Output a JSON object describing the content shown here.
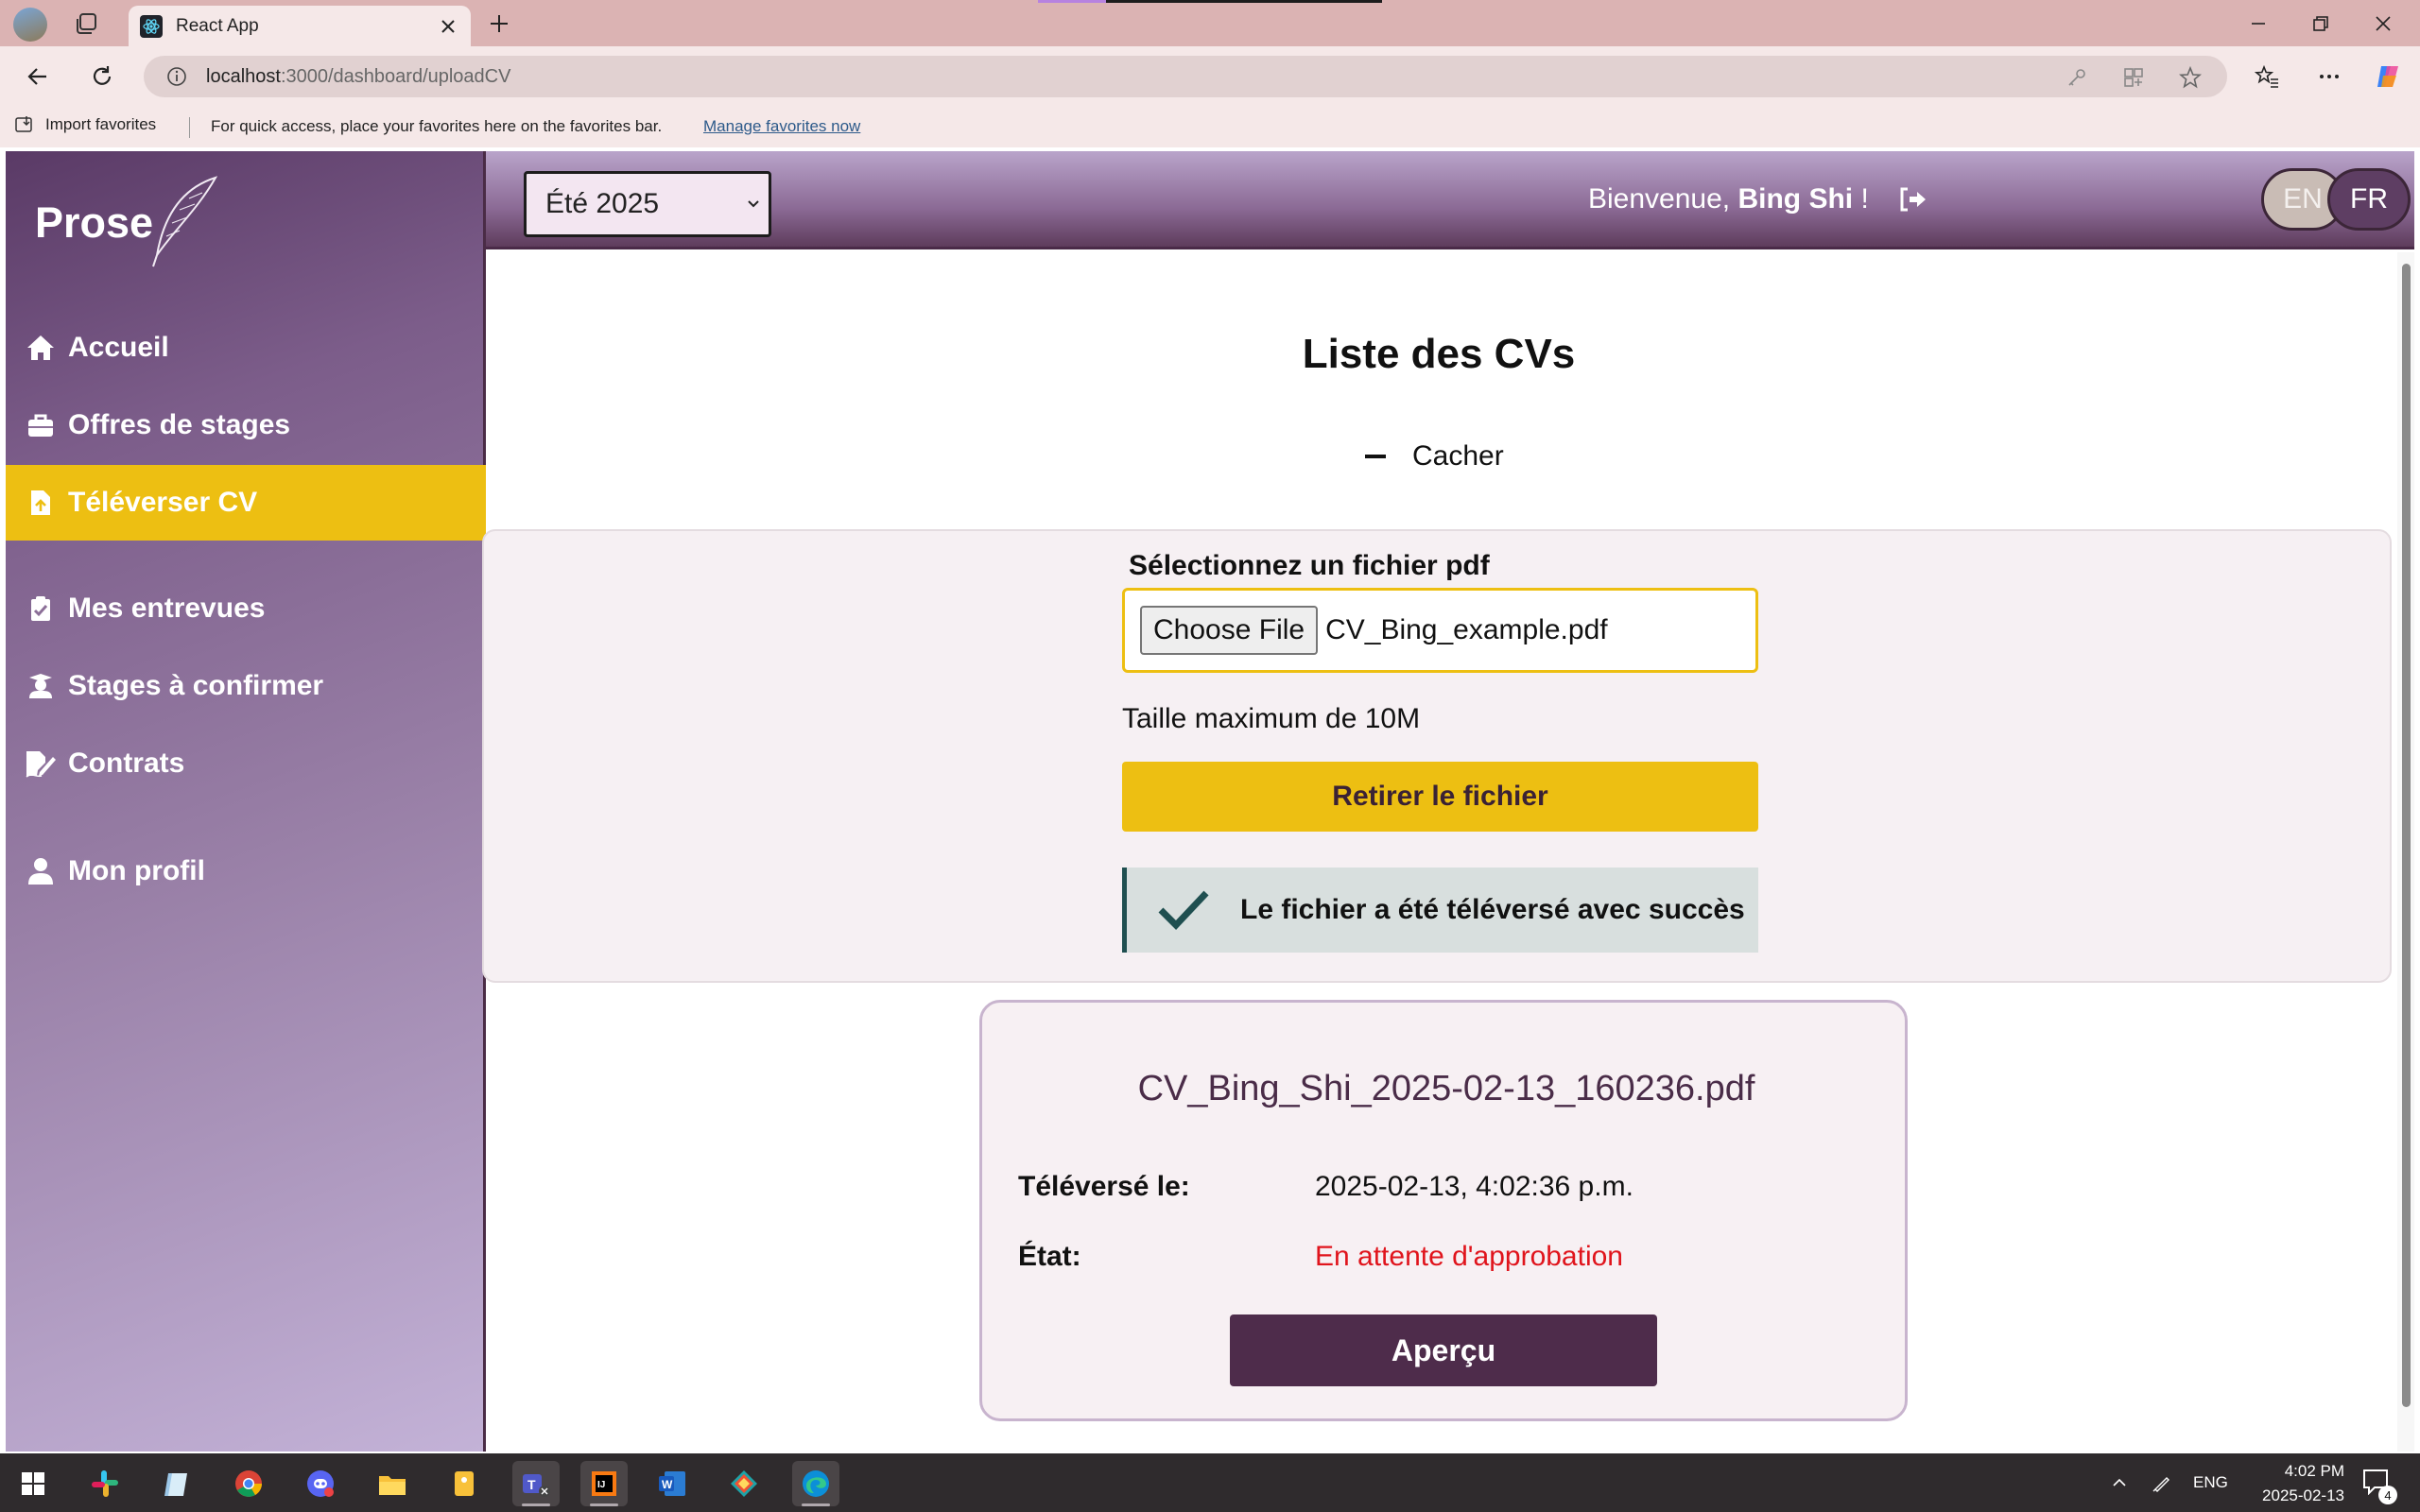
{
  "browser": {
    "tab_title": "React App",
    "url_host": "localhost",
    "url_path": ":3000/dashboard/uploadCV",
    "favorites": {
      "import_label": "Import favorites",
      "hint": "For quick access, place your favorites here on the favorites bar.",
      "manage_link": "Manage favorites now"
    }
  },
  "app": {
    "logo": "Prose",
    "nav": [
      {
        "label": "Accueil",
        "icon": "home-icon"
      },
      {
        "label": "Offres de stages",
        "icon": "briefcase-icon"
      },
      {
        "label": "Téléverser CV",
        "icon": "file-upload-icon",
        "active": true
      },
      {
        "label": "Mes entrevues",
        "icon": "clipboard-check-icon"
      },
      {
        "label": "Stages à confirmer",
        "icon": "graduate-icon"
      },
      {
        "label": "Contrats",
        "icon": "signature-icon"
      },
      {
        "label": "Mon profil",
        "icon": "user-icon"
      }
    ],
    "header": {
      "session": "Été 2025",
      "welcome_prefix": "Bienvenue,",
      "user_name": "Bing Shi",
      "welcome_suffix": "!",
      "lang_en": "EN",
      "lang_fr": "FR"
    },
    "page": {
      "title": "Liste des CVs",
      "hide_toggle": "Cacher",
      "upload": {
        "label": "Sélectionnez un fichier pdf",
        "choose_button": "Choose File",
        "file_name": "CV_Bing_example.pdf",
        "max_size": "Taille maximum de 10M",
        "remove_button": "Retirer le fichier",
        "success": "Le fichier a été téléversé avec succès"
      },
      "cv": {
        "file_name": "CV_Bing_Shi_2025-02-13_160236.pdf",
        "uploaded_label": "Téléversé le:",
        "uploaded_value": "2025-02-13, 4:02:36 p.m.",
        "status_label": "État:",
        "status_value": "En attente d'approbation",
        "preview_button": "Aperçu"
      }
    }
  },
  "taskbar": {
    "language": "ENG",
    "time": "4:02 PM",
    "date": "2025-02-13",
    "notifications": "4"
  },
  "colors": {
    "accent_yellow": "#edbf12",
    "brand_purple": "#4e2c4b",
    "pending_red": "#e0141c",
    "success_teal": "#1f4f50"
  }
}
